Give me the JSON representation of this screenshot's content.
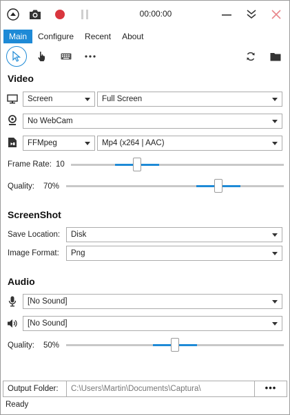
{
  "header": {
    "timer": "00:00:00"
  },
  "tabs": [
    {
      "label": "Main",
      "active": true
    },
    {
      "label": "Configure",
      "active": false
    },
    {
      "label": "Recent",
      "active": false
    },
    {
      "label": "About",
      "active": false
    }
  ],
  "toolbar": {
    "tools": [
      "cursor-icon",
      "hand-click-icon",
      "keyboard-icon",
      "more-icon"
    ],
    "right": [
      "refresh-icon",
      "folder-icon"
    ]
  },
  "video": {
    "title": "Video",
    "source": "Screen",
    "region": "Full Screen",
    "webcam": "No WebCam",
    "encoder": "FFMpeg",
    "format": "Mp4 (x264 | AAC)",
    "frame_rate_label": "Frame Rate:",
    "frame_rate_value": "10",
    "frame_rate_level": 0.31,
    "quality_label": "Quality:",
    "quality_value": "70%",
    "quality_level": 0.7
  },
  "screenshot": {
    "title": "ScreenShot",
    "save_location_label": "Save Location:",
    "save_location": "Disk",
    "image_format_label": "Image Format:",
    "image_format": "Png"
  },
  "audio": {
    "title": "Audio",
    "microphone": "[No Sound]",
    "speaker": "[No Sound]",
    "quality_label": "Quality:",
    "quality_value": "50%",
    "quality_level": 0.5
  },
  "footer": {
    "output_folder_label": "Output Folder:",
    "output_folder_path": "C:\\Users\\Martin\\Documents\\Captura\\",
    "browse_label": "•••",
    "status": "Ready"
  },
  "colors": {
    "accent": "#1e8ad6",
    "record": "#d9363e",
    "close": "#e8868b"
  }
}
